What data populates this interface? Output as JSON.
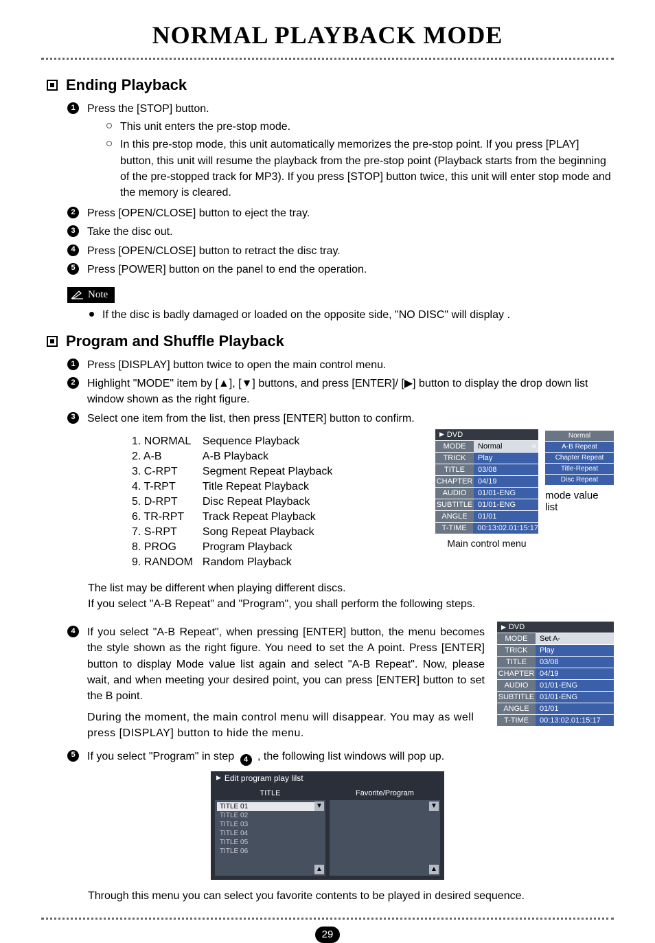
{
  "page_title": "NORMAL PLAYBACK MODE",
  "page_number": "29",
  "section_ending": {
    "heading": "Ending Playback",
    "step1": "Press the [STOP] button.",
    "step1_sub1": "This unit enters the pre-stop mode.",
    "step1_sub2": "In this pre-stop mode, this unit automatically memorizes the pre-stop point. If you press [PLAY] button, this unit will resume the playback from the pre-stop point (Playback starts from the beginning of the pre-stopped track for MP3). If you press [STOP] button twice, this unit will enter stop mode and the memory is cleared.",
    "step2": "Press [OPEN/CLOSE] button to eject the tray.",
    "step3": "Take the disc out.",
    "step4": "Press [OPEN/CLOSE] button to retract the disc tray.",
    "step5": "Press [POWER] button on the panel to end the operation.",
    "note_label": "Note",
    "note_text": "If the disc is badly damaged or loaded on the opposite side, \"NO DISC\" will display ."
  },
  "section_program": {
    "heading": "Program and Shuffle Playback",
    "step1": "Press [DISPLAY] button twice to open the main control menu.",
    "step2": "Highlight \"MODE\" item by [▲], [▼] buttons, and press [ENTER]/ [▶] button to display the drop down list window shown as the right figure.",
    "step3": "Select one item from the list, then press [ENTER] button to confirm.",
    "modes": [
      {
        "k": "1. NORMAL",
        "v": "Sequence Playback"
      },
      {
        "k": "2. A-B",
        "v": "A-B Playback"
      },
      {
        "k": "3. C-RPT",
        "v": "Segment Repeat Playback"
      },
      {
        "k": "4. T-RPT",
        "v": "Title Repeat Playback"
      },
      {
        "k": "5. D-RPT",
        "v": "Disc Repeat Playback"
      },
      {
        "k": "6. TR-RPT",
        "v": "Track Repeat Playback"
      },
      {
        "k": "7. S-RPT",
        "v": "Song Repeat Playback"
      },
      {
        "k": "8. PROG",
        "v": "Program Playback"
      },
      {
        "k": "9. RANDOM",
        "v": "Random Playback"
      }
    ],
    "para_diff": "The list may be different when playing different discs.",
    "para_follow": "If you select \"A-B Repeat\" and \"Program\", you shall perform the following steps.",
    "step4": "If you select \"A-B Repeat\", when pressing [ENTER] button, the menu becomes the style shown as the right figure. You need to set the A point. Press [ENTER] button to display Mode value list again and select \"A-B Repeat\". Now, please wait, and when meeting your desired point, you can press [ENTER] button to set the B point.",
    "step4_extra": "During the moment, the main control menu will disappear. You may as well press [DISPLAY] button to hide the menu.",
    "step5_pre": "If you select \"Program\" in step ",
    "step5_post": " , the following list windows will pop up.",
    "step5_ref": "4",
    "final_line": "Through this menu you can select you favorite contents to be played in desired sequence."
  },
  "osd1": {
    "header": "DVD",
    "rows": [
      {
        "l": "MODE",
        "v": "Normal",
        "light": true,
        "arrow": true
      },
      {
        "l": "TRICK",
        "v": "Play"
      },
      {
        "l": "TITLE",
        "v": "03/08"
      },
      {
        "l": "CHAPTER",
        "v": "04/19"
      },
      {
        "l": "AUDIO",
        "v": "01/01-ENG"
      },
      {
        "l": "SUBTITLE",
        "v": "01/01-ENG"
      },
      {
        "l": "ANGLE",
        "v": "01/01"
      },
      {
        "l": "T-TIME",
        "v": "00:13:02.01:15:17"
      }
    ],
    "mode_list": [
      "Normal",
      "A-B Repeat",
      "Chapter Repeat",
      "Title-Repeat",
      "Disc Repeat"
    ],
    "side_caption": "mode value list",
    "caption": "Main control menu"
  },
  "osd2": {
    "header": "DVD",
    "rows": [
      {
        "l": "MODE",
        "v": "Set A-",
        "light": true
      },
      {
        "l": "TRICK",
        "v": "Play"
      },
      {
        "l": "TITLE",
        "v": "03/08"
      },
      {
        "l": "CHAPTER",
        "v": "04/19"
      },
      {
        "l": "AUDIO",
        "v": "01/01-ENG"
      },
      {
        "l": "SUBTITLE",
        "v": "01/01-ENG"
      },
      {
        "l": "ANGLE",
        "v": "01/01"
      },
      {
        "l": "T-TIME",
        "v": "00:13:02.01:15:17"
      }
    ]
  },
  "prog_editor": {
    "header": "Edit program play lilst",
    "col1_title": "TITLE",
    "col2_title": "Favorite/Program",
    "titles": [
      "TITLE  01",
      "TITLE  02",
      "TITLE  03",
      "TITLE  04",
      "TITLE  05",
      "TITLE  06"
    ]
  }
}
